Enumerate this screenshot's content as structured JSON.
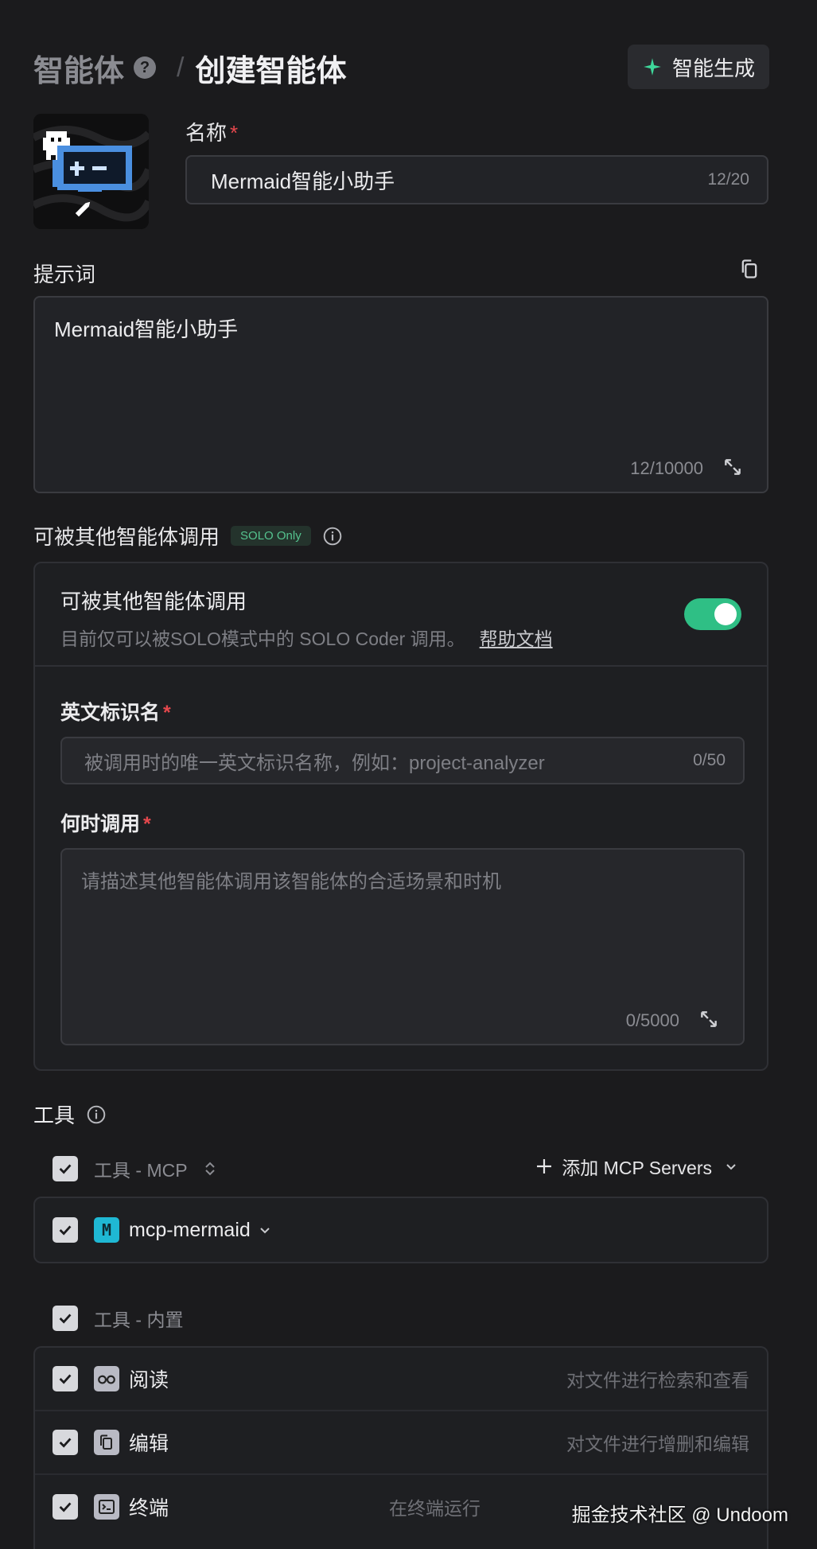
{
  "header": {
    "breadcrumb_parent": "智能体",
    "breadcrumb_separator": "/",
    "breadcrumb_current": "创建智能体",
    "help_icon_glyph": "?",
    "generate_button_label": "智能生成"
  },
  "name_field": {
    "label": "名称",
    "required_mark": "*",
    "value": "Mermaid智能小助手",
    "counter": "12/20"
  },
  "prompt_field": {
    "label": "提示词",
    "value": "Mermaid智能小助手",
    "counter": "12/10000"
  },
  "callable": {
    "section_title": "可被其他智能体调用",
    "badge": "SOLO Only",
    "card_title": "可被其他智能体调用",
    "card_desc": "目前仅可以被SOLO模式中的 SOLO Coder 调用。",
    "help_link": "帮助文档",
    "toggle_on": true,
    "english_id_label": "英文标识名",
    "english_id_placeholder": "被调用时的唯一英文标识名称，例如：project-analyzer",
    "english_id_counter": "0/50",
    "when_label": "何时调用",
    "when_placeholder": "请描述其他智能体调用该智能体的合适场景和时机",
    "when_counter": "0/5000"
  },
  "tools": {
    "title": "工具",
    "mcp_group_label": "工具 - MCP",
    "add_mcp_label": "添加 MCP Servers",
    "mcp_items": [
      {
        "name": "mcp-mermaid",
        "icon_letter": "M"
      }
    ],
    "builtin_group_label": "工具 - 内置",
    "builtin_items": [
      {
        "name": "阅读",
        "desc": "对文件进行检索和查看",
        "icon": "glasses-icon"
      },
      {
        "name": "编辑",
        "desc": "对文件进行增删和编辑",
        "icon": "files-icon"
      },
      {
        "name": "终端",
        "desc": "在终端运行",
        "icon": "terminal-icon"
      }
    ]
  },
  "watermark": "掘金技术社区 @ Undoom",
  "colors": {
    "accent_green": "#2fbf85",
    "required_red": "#e5484d",
    "background": "#1b1b1d"
  }
}
